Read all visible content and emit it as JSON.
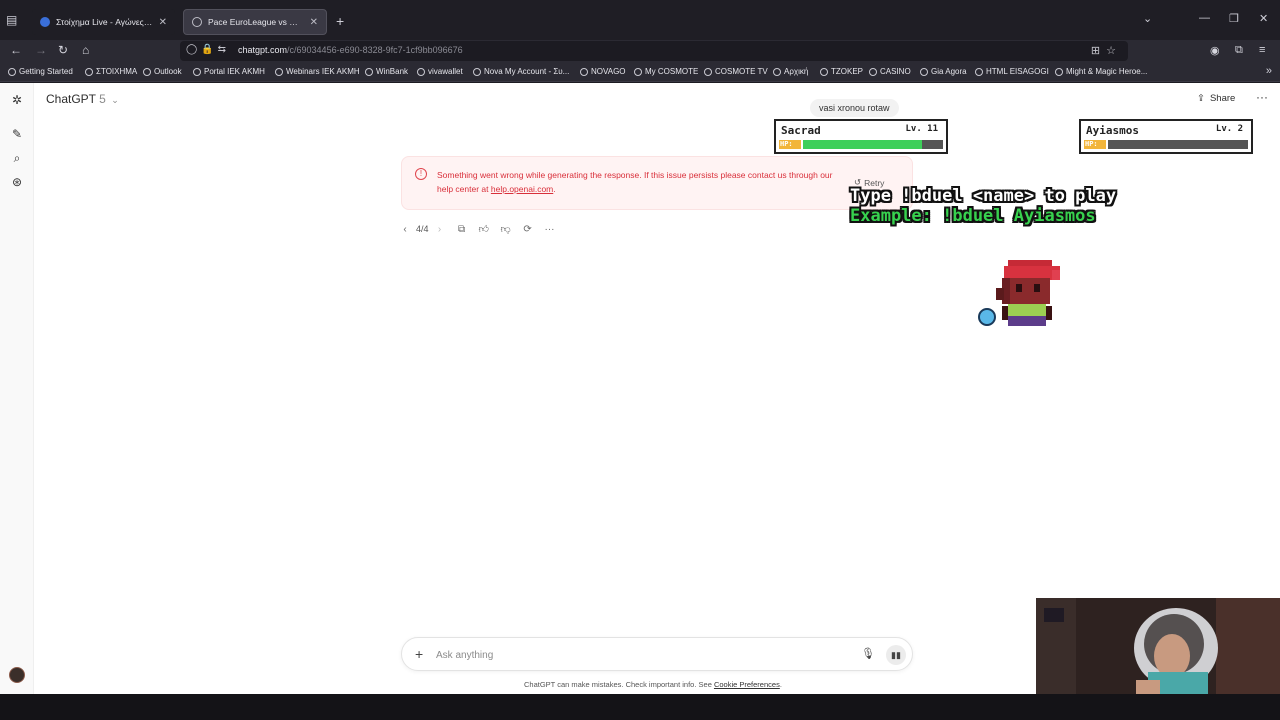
{
  "browser": {
    "tabs": [
      {
        "title": "Στοίχημα Live - Αγώνες Σήμερα",
        "fav_color": "#3a6fd8"
      },
      {
        "title": "Pace EuroLeague vs NBA",
        "fav_color": "#bdbdc6"
      }
    ],
    "url": {
      "host": "chatgpt.com",
      "path": "/c/69034456-e690-8328-9fc7-1cf9bb096676"
    },
    "bookmarks": [
      "Getting Started",
      "ΣΤΟΙΧΗΜΑ",
      "Outlook",
      "Portal IEK AKMH",
      "Webinars IEK AKMH",
      "WinBank",
      "vivawallet",
      "Nova My Account - Συ...",
      "NOVAGO",
      "My COSMOTE",
      "COSMOTE TV",
      "Αρχική",
      "TZOKEP",
      "CASINO",
      "Gia Agora",
      "HTML EISAGOGI",
      "Might & Magic Heroe..."
    ]
  },
  "app": {
    "model_name": "ChatGPT",
    "model_version": "5",
    "share_label": "Share",
    "user_message": "vasi xronou rotaw",
    "error": {
      "text": "Something went wrong while generating the response. If this issue persists please contact us through our help center at",
      "link": "help.openai.com",
      "tail": ".",
      "retry_label": "Retry"
    },
    "pager": "4/4",
    "composer_placeholder": "Ask anything",
    "disclaimer": "ChatGPT can make mistakes. Check important info. See",
    "disclaimer_link": "Cookie Preferences",
    "disclaimer_tail": "."
  },
  "overlay": {
    "players": [
      {
        "name": "Sacrad",
        "level": "Lv. 11",
        "hp_label": "HP:",
        "hp_fraction": 0.85
      },
      {
        "name": "Ayiasmos",
        "level": "Lv. 2",
        "hp_label": "HP:",
        "hp_fraction": 0.0
      }
    ],
    "line1": "Type !bduel <name> to play",
    "line2": "Example: !bduel Ayiasmos"
  },
  "colors": {
    "error_red": "#d92f3a",
    "hp_green": "#3ecf5a",
    "hp_label_orange": "#f2b53a"
  }
}
